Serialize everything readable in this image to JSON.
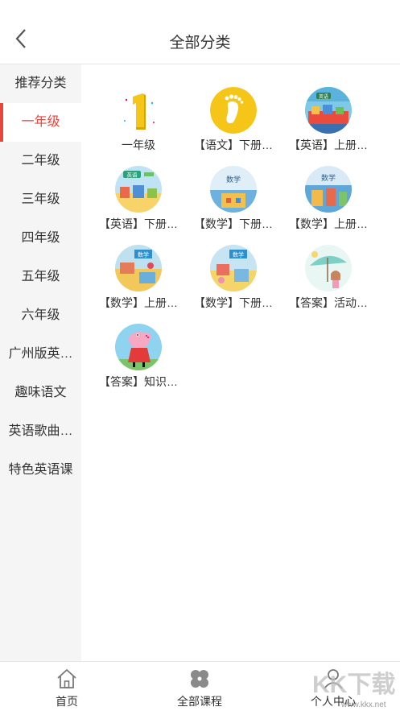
{
  "header": {
    "title": "全部分类",
    "back_icon": "back-arrow-icon"
  },
  "sidebar": {
    "items": [
      {
        "label": "推荐分类"
      },
      {
        "label": "一年级",
        "active": true
      },
      {
        "label": "二年级"
      },
      {
        "label": "三年级"
      },
      {
        "label": "四年级"
      },
      {
        "label": "五年级"
      },
      {
        "label": "六年级"
      },
      {
        "label": "广州版英…"
      },
      {
        "label": "趣味语文"
      },
      {
        "label": "英语歌曲…"
      },
      {
        "label": "特色英语课"
      }
    ],
    "active_color": "#e8463c"
  },
  "grid": {
    "items": [
      {
        "label": "一年级",
        "icon": "number-one-icon"
      },
      {
        "label": "【语文】下册…",
        "icon": "footprint-icon"
      },
      {
        "label": "【英语】上册…",
        "icon": "english-textbook-cover"
      },
      {
        "label": "【英语】下册…",
        "icon": "english-textbook-cover"
      },
      {
        "label": "【数学】下册…",
        "icon": "math-textbook-cover"
      },
      {
        "label": "【数学】上册…",
        "icon": "math-textbook-cover"
      },
      {
        "label": "【数学】上册…",
        "icon": "math-textbook-cover"
      },
      {
        "label": "【数学】下册…",
        "icon": "math-textbook-cover"
      },
      {
        "label": "【答案】活动…",
        "icon": "umbrella-girl-illustration"
      },
      {
        "label": "【答案】知识…",
        "icon": "peppa-pig-illustration"
      }
    ]
  },
  "tabbar": {
    "tabs": [
      {
        "label": "首页",
        "icon": "home-icon"
      },
      {
        "label": "全部课程",
        "icon": "clover-icon"
      },
      {
        "label": "个人中心",
        "icon": "person-icon"
      }
    ]
  },
  "watermark": {
    "text": "KK下载",
    "url": "www.kkx.net"
  }
}
